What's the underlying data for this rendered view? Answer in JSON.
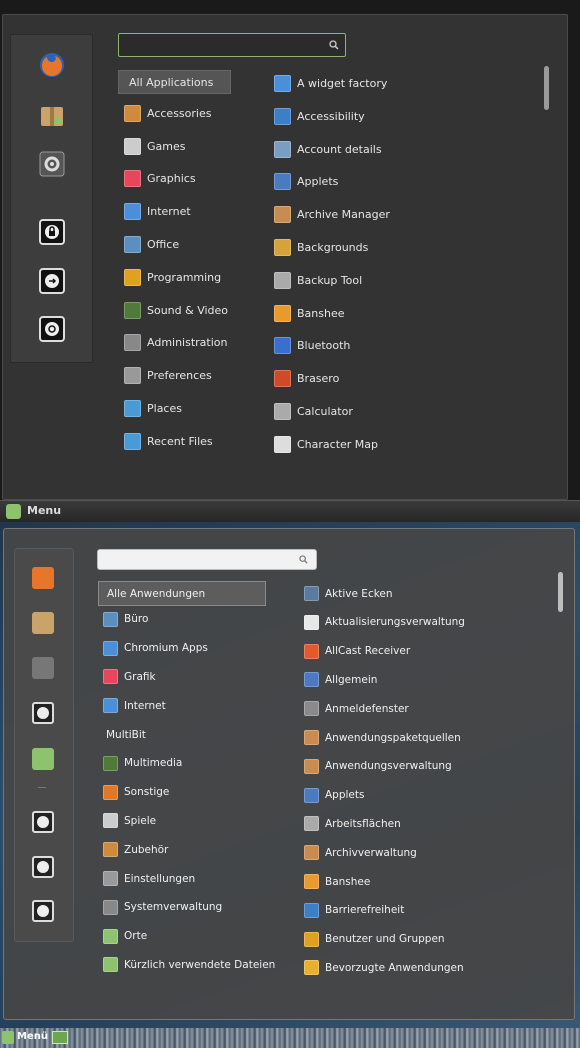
{
  "top": {
    "search": {
      "value": "",
      "icon": "search-icon"
    },
    "categories": [
      {
        "label": "All Applications",
        "icon": "all-icon",
        "color": "#555555"
      },
      {
        "label": "Accessories",
        "icon": "accessories-icon",
        "color": "#d08a3c"
      },
      {
        "label": "Games",
        "icon": "games-icon",
        "color": "#cccccc"
      },
      {
        "label": "Graphics",
        "icon": "graphics-icon",
        "color": "#e8465a"
      },
      {
        "label": "Internet",
        "icon": "internet-icon",
        "color": "#4a8fd8"
      },
      {
        "label": "Office",
        "icon": "office-icon",
        "color": "#5a8fc0"
      },
      {
        "label": "Programming",
        "icon": "programming-icon",
        "color": "#e0a020"
      },
      {
        "label": "Sound & Video",
        "icon": "sound-video-icon",
        "color": "#4f7a38"
      },
      {
        "label": "Administration",
        "icon": "administration-icon",
        "color": "#888888"
      },
      {
        "label": "Preferences",
        "icon": "preferences-icon",
        "color": "#999999"
      },
      {
        "label": "Places",
        "icon": "places-icon",
        "color": "#4a9ad6"
      },
      {
        "label": "Recent Files",
        "icon": "recent-files-icon",
        "color": "#4a9ad6"
      }
    ],
    "apps": [
      {
        "label": "A widget factory",
        "icon": "widget-factory-icon",
        "color": "#4a8fd8"
      },
      {
        "label": "Accessibility",
        "icon": "accessibility-icon",
        "color": "#3d7fc7"
      },
      {
        "label": "Account details",
        "icon": "account-details-icon",
        "color": "#7a9dc0"
      },
      {
        "label": "Applets",
        "icon": "applets-icon",
        "color": "#4a7ac0"
      },
      {
        "label": "Archive Manager",
        "icon": "archive-manager-icon",
        "color": "#c98c4f"
      },
      {
        "label": "Backgrounds",
        "icon": "backgrounds-icon",
        "color": "#d6a23a"
      },
      {
        "label": "Backup Tool",
        "icon": "backup-tool-icon",
        "color": "#aaaaaa"
      },
      {
        "label": "Banshee",
        "icon": "banshee-icon",
        "color": "#e89a2a"
      },
      {
        "label": "Bluetooth",
        "icon": "bluetooth-icon",
        "color": "#3a6fd0"
      },
      {
        "label": "Brasero",
        "icon": "brasero-icon",
        "color": "#d04a2a"
      },
      {
        "label": "Calculator",
        "icon": "calculator-icon",
        "color": "#aaaaaa"
      },
      {
        "label": "Character Map",
        "icon": "character-map-icon",
        "color": "#dddddd"
      }
    ],
    "favorites": [
      {
        "name": "firefox-icon",
        "color": "#e8762a"
      },
      {
        "name": "package-icon",
        "color": "#c9a36a"
      },
      {
        "name": "system-settings-icon",
        "color": "#777777"
      },
      {
        "name": "lock-icon",
        "color": "#222222"
      },
      {
        "name": "logout-icon",
        "color": "#222222"
      },
      {
        "name": "shutdown-icon",
        "color": "#222222"
      }
    ]
  },
  "strip": {
    "label": "Menu"
  },
  "bottom": {
    "search": {
      "value": "",
      "icon": "search-icon"
    },
    "categories": [
      {
        "label": "Alle Anwendungen",
        "icon": "",
        "color": ""
      },
      {
        "label": "Büro",
        "icon": "office-icon",
        "color": "#5a8fc0"
      },
      {
        "label": "Chromium Apps",
        "icon": "chromium-icon",
        "color": "#4a8fd8"
      },
      {
        "label": "Grafik",
        "icon": "graphics-icon",
        "color": "#e8465a"
      },
      {
        "label": "Internet",
        "icon": "internet-icon",
        "color": "#4a8fd8"
      },
      {
        "label": "MultiBit",
        "icon": "",
        "color": ""
      },
      {
        "label": "Multimedia",
        "icon": "multimedia-icon",
        "color": "#4f7a38"
      },
      {
        "label": "Sonstige",
        "icon": "other-icon",
        "color": "#e0782a"
      },
      {
        "label": "Spiele",
        "icon": "games-icon",
        "color": "#cccccc"
      },
      {
        "label": "Zubehör",
        "icon": "accessories-icon",
        "color": "#d08a3c"
      },
      {
        "label": "Einstellungen",
        "icon": "preferences-icon",
        "color": "#999999"
      },
      {
        "label": "Systemverwaltung",
        "icon": "administration-icon",
        "color": "#888888"
      },
      {
        "label": "Orte",
        "icon": "places-icon",
        "color": "#8dc26f"
      },
      {
        "label": "Kürzlich verwendete Dateien",
        "icon": "recent-files-icon",
        "color": "#8dc26f"
      }
    ],
    "apps": [
      {
        "label": "Aktive Ecken",
        "icon": "hot-corners-icon",
        "color": "#5a7aa0"
      },
      {
        "label": "Aktualisierungsverwaltung",
        "icon": "update-manager-icon",
        "color": "#e8e8e8"
      },
      {
        "label": "AllCast Receiver",
        "icon": "allcast-icon",
        "color": "#e05a2a"
      },
      {
        "label": "Allgemein",
        "icon": "general-icon",
        "color": "#4a7ac0"
      },
      {
        "label": "Anmeldefenster",
        "icon": "login-window-icon",
        "color": "#8a8a8a"
      },
      {
        "label": "Anwendungspaketquellen",
        "icon": "software-sources-icon",
        "color": "#c98c4f"
      },
      {
        "label": "Anwendungsverwaltung",
        "icon": "software-manager-icon",
        "color": "#c98c4f"
      },
      {
        "label": "Applets",
        "icon": "applets-icon",
        "color": "#4a7ac0"
      },
      {
        "label": "Arbeitsflächen",
        "icon": "workspaces-icon",
        "color": "#aaaaaa"
      },
      {
        "label": "Archivverwaltung",
        "icon": "archive-manager-icon",
        "color": "#c98c4f"
      },
      {
        "label": "Banshee",
        "icon": "banshee-icon",
        "color": "#e89a2a"
      },
      {
        "label": "Barrierefreiheit",
        "icon": "accessibility-icon",
        "color": "#3d7fc7"
      },
      {
        "label": "Benutzer und Gruppen",
        "icon": "users-groups-icon",
        "color": "#e0a020"
      },
      {
        "label": "Bevorzugte Anwendungen",
        "icon": "preferred-apps-icon",
        "color": "#e8b030"
      }
    ],
    "favorites": [
      {
        "name": "firefox-icon",
        "color": "#e8762a"
      },
      {
        "name": "package-icon",
        "color": "#c9a36a"
      },
      {
        "name": "system-settings-icon",
        "color": "#777777"
      },
      {
        "name": "terminal-icon",
        "color": "#222222"
      },
      {
        "name": "folder-icon",
        "color": "#8dc26f"
      },
      {
        "name": "lock-icon",
        "color": "#222222"
      },
      {
        "name": "logout-icon",
        "color": "#222222"
      },
      {
        "name": "shutdown-icon",
        "color": "#222222"
      }
    ]
  },
  "panel": {
    "label": "Menü"
  }
}
